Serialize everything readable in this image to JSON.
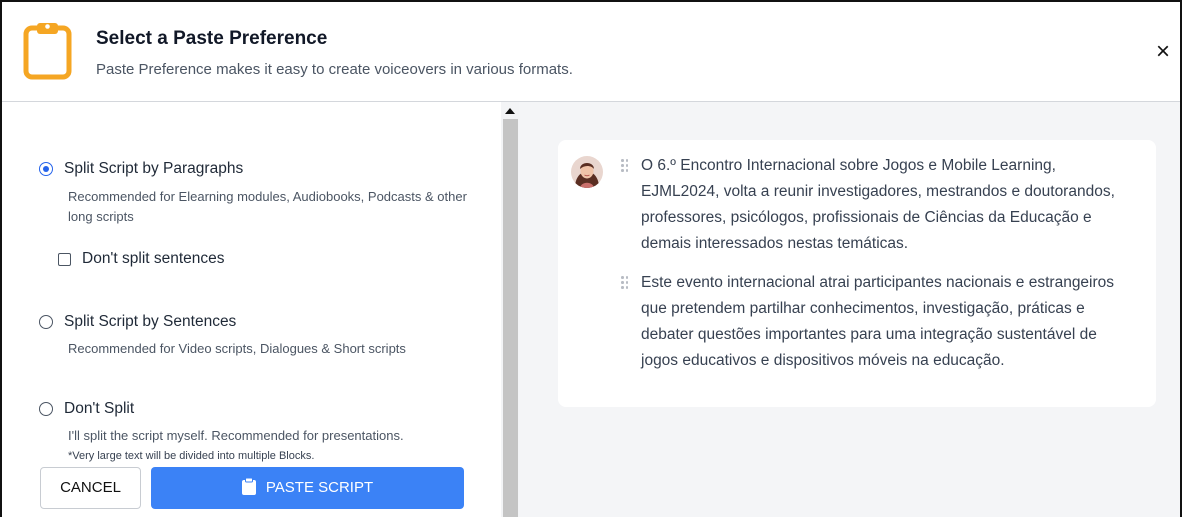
{
  "header": {
    "title": "Select a Paste Preference",
    "subtitle": "Paste Preference makes it easy to create voiceovers in various formats.",
    "close_label": "×"
  },
  "options": {
    "paragraphs": {
      "label": "Split Script by Paragraphs",
      "description": "Recommended for Elearning modules, Audiobooks, Podcasts & other long scripts",
      "checked": true
    },
    "dont_split_sentences": {
      "label": "Don't split sentences",
      "checked": false
    },
    "sentences": {
      "label": "Split Script by Sentences",
      "description": "Recommended for Video scripts, Dialogues & Short scripts",
      "checked": false
    },
    "dont_split": {
      "label": "Don't Split",
      "description": "I'll split the script myself. Recommended for presentations.",
      "note": "*Very large text will be divided into multiple Blocks.",
      "checked": false
    }
  },
  "buttons": {
    "cancel": "CANCEL",
    "paste": "PASTE SCRIPT"
  },
  "preview": {
    "paragraphs": [
      "O 6.º Encontro Internacional sobre Jogos e Mobile Learning, EJML2024, volta a reunir investigadores, mestrandos e doutorandos, professores, psicólogos, profissionais de Ciências da Educação e demais interessados nestas temáticas.",
      "Este evento internacional atrai participantes nacionais e estrangeiros que pretendem partilhar conhecimentos, investigação, práticas e debater questões importantes para uma integração sustentável de jogos educativos e dispositivos móveis na educação."
    ]
  },
  "colors": {
    "accent": "#3b82f6",
    "radio_checked": "#2563eb",
    "clipboard_icon": "#f5a623",
    "preview_bg": "#f4f5f7"
  }
}
